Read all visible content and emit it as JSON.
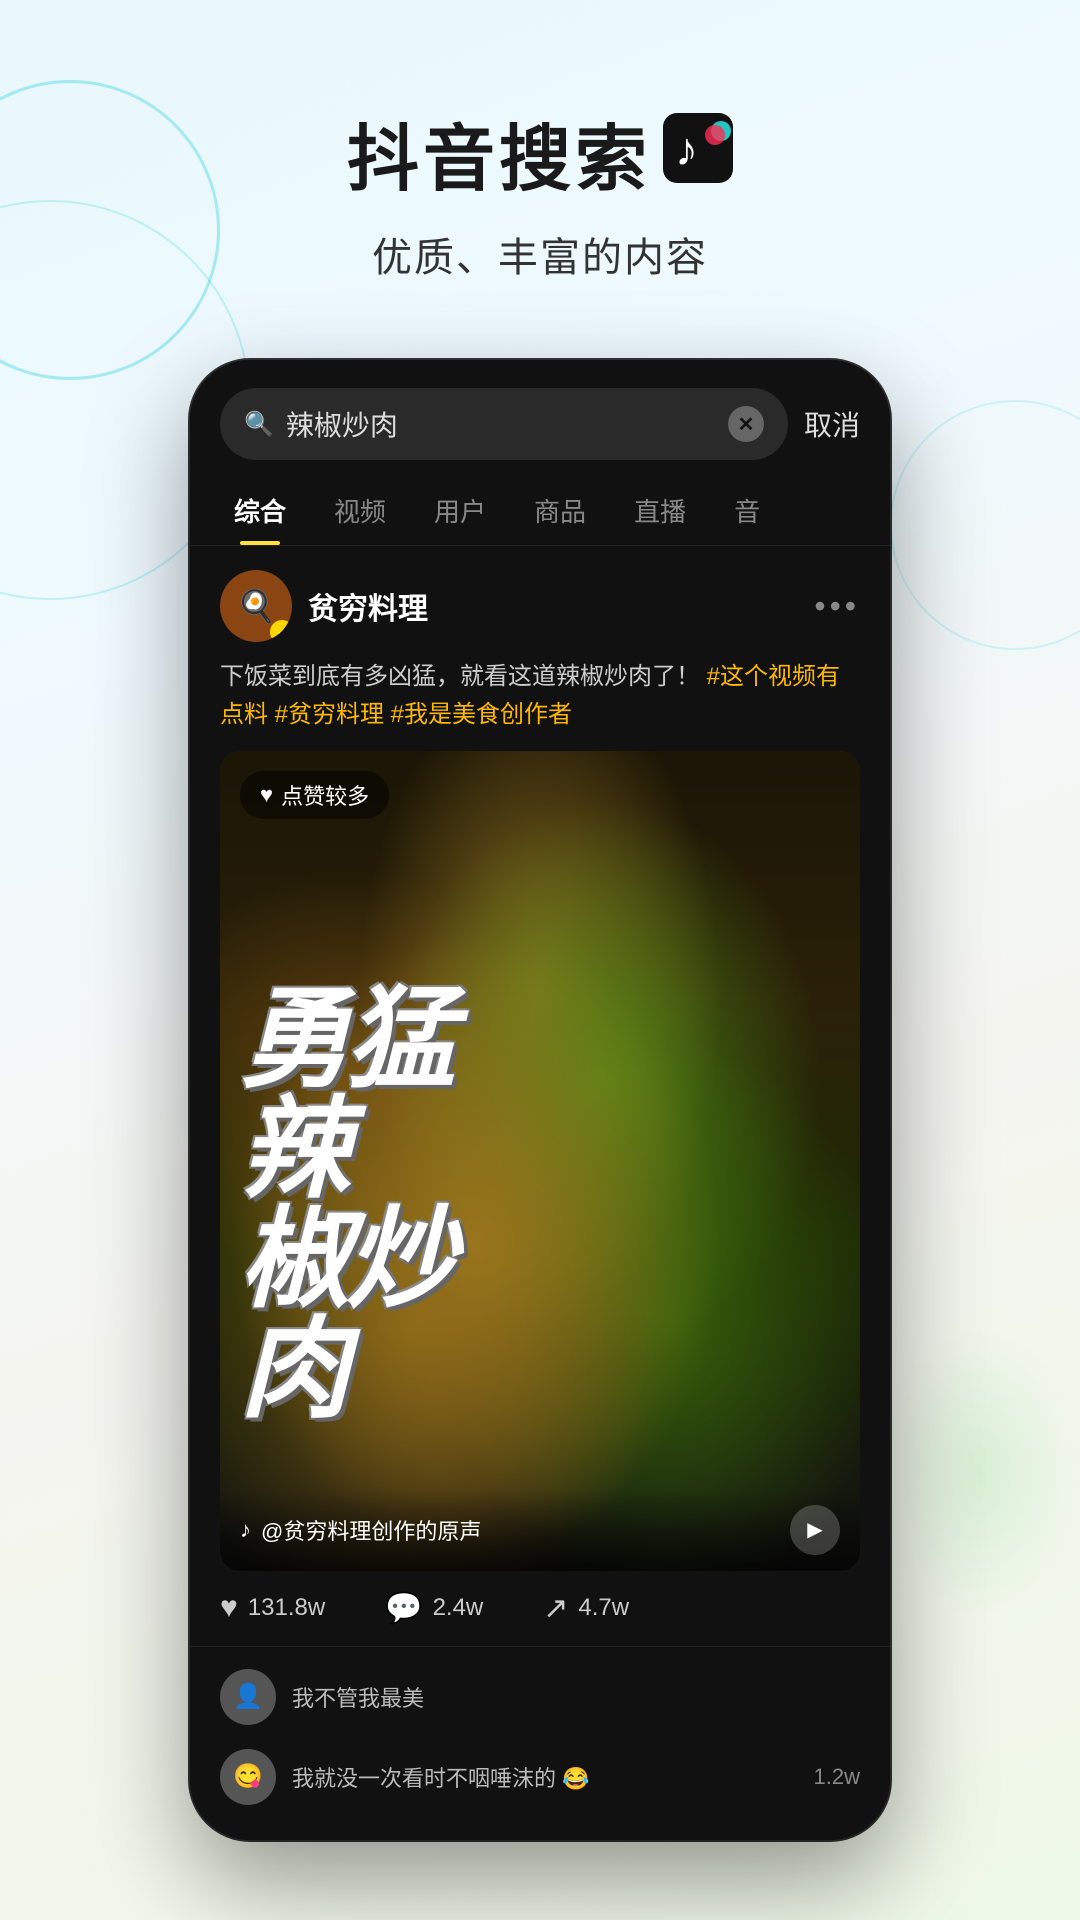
{
  "header": {
    "main_title": "抖音搜索",
    "tiktok_icon": "♪",
    "subtitle": "优质、丰富的内容"
  },
  "search": {
    "query": "辣椒炒肉",
    "cancel_label": "取消",
    "placeholder": "辣椒炒肉"
  },
  "tabs": [
    {
      "label": "综合",
      "active": true
    },
    {
      "label": "视频",
      "active": false
    },
    {
      "label": "用户",
      "active": false
    },
    {
      "label": "商品",
      "active": false
    },
    {
      "label": "直播",
      "active": false
    },
    {
      "label": "音",
      "active": false
    }
  ],
  "post": {
    "username": "贫穷料理",
    "verified": true,
    "verified_icon": "✓",
    "more_icon": "•••",
    "text_normal": "下饭菜到底有多凶猛，就看这道辣椒炒肉了！",
    "hashtags": "#这个视频有点料 #贫穷料理 #我是美食创作者",
    "like_badge": "点赞较多",
    "video_text": "勇猛辣椒炒肉",
    "video_text_lines": [
      "勇",
      "猛",
      "辣",
      "椒炒",
      "肉"
    ],
    "audio_text": "@贫穷料理创作的原声",
    "tiktok_icon": "♪"
  },
  "engagement": {
    "likes": "131.8w",
    "comments": "2.4w",
    "shares": "4.7w",
    "like_icon": "♥",
    "comment_icon": "💬",
    "share_icon": "➤"
  },
  "comments": [
    {
      "avatar_text": "👤",
      "text": "我不管我最美",
      "count": ""
    },
    {
      "avatar_text": "😋",
      "text": "我就没一次看时不咽唾沫的",
      "count": "1.2w"
    }
  ]
}
